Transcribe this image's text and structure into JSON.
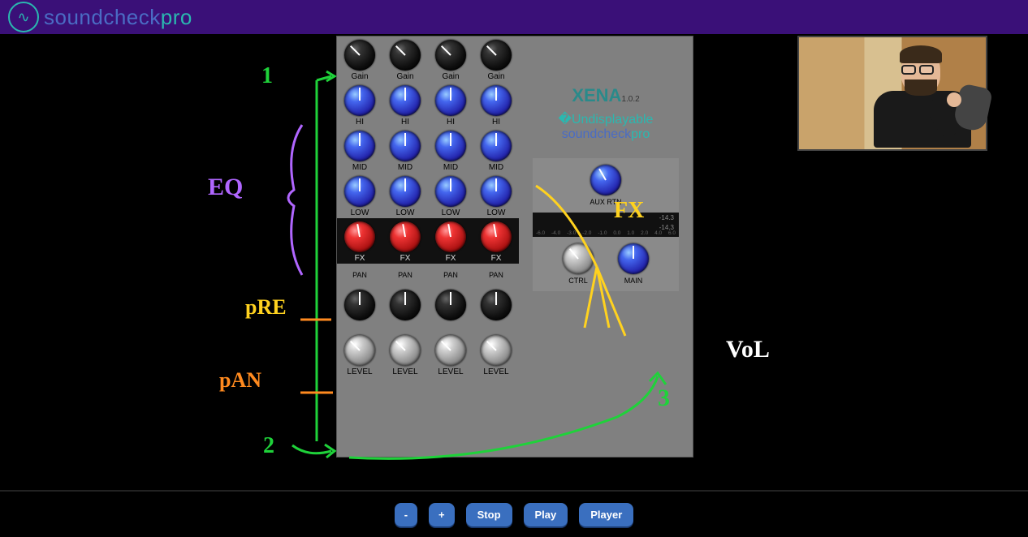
{
  "header": {
    "brand_a": "soundcheck",
    "brand_b": "pro"
  },
  "mixer": {
    "channel_labels": {
      "gain": "Gain",
      "hi": "HI",
      "mid": "MID",
      "low": "LOW",
      "fx": "FX",
      "pan": "PAN",
      "level": "LEVEL"
    },
    "channels": 4,
    "master": {
      "product": "XENA",
      "version": "1.0.2",
      "brand_a": "soundcheck",
      "brand_b": "pro",
      "aux_label": "AUX RTN",
      "ctrl_label": "CTRL",
      "main_label": "MAIN",
      "meter_val_a": "-14.3",
      "meter_val_b": "-14.3",
      "meter_ticks": [
        "-6.0",
        "-4.0",
        "-3.0",
        "-2.0",
        "-1.0",
        "0.0",
        "1.0",
        "2.0",
        "4.0",
        "6.0"
      ]
    }
  },
  "transport": {
    "minus": "-",
    "plus": "+",
    "stop": "Stop",
    "play": "Play",
    "player": "Player"
  },
  "annotations": {
    "one": "1",
    "two": "2",
    "three": "3",
    "eq": "EQ",
    "pre": "pRE",
    "pan": "pAN",
    "fx": "FX",
    "vol": "VoL"
  }
}
